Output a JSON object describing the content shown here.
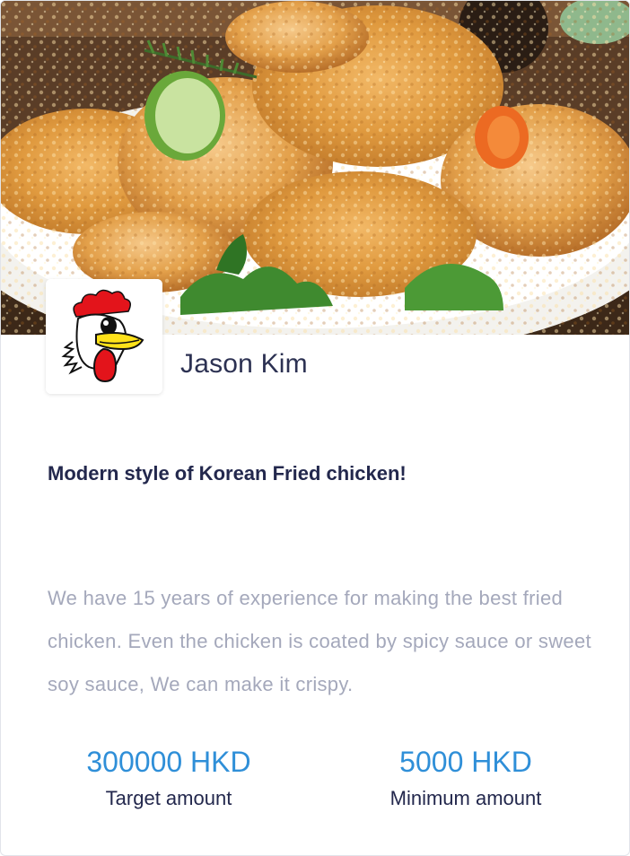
{
  "hero": {
    "image_subject": "fried chicken on a plate"
  },
  "owner": {
    "logo_icon": "rooster-mascot-icon",
    "name": "Jason Kim"
  },
  "campaign": {
    "headline": "Modern style of Korean Fried chicken!",
    "description": "We have 15 years of experience for making the best fried chicken. Even the chicken is coated by spicy sauce or sweet soy sauce, We can make it crispy."
  },
  "stats": {
    "target": {
      "value": "300000 HKD",
      "label": "Target amount"
    },
    "minimum": {
      "value": "5000 HKD",
      "label": "Minimum amount"
    }
  },
  "colors": {
    "accent": "#2f8fd8",
    "heading": "#23284d",
    "muted_text": "#a4a8bb",
    "border": "#e1e4ea"
  }
}
